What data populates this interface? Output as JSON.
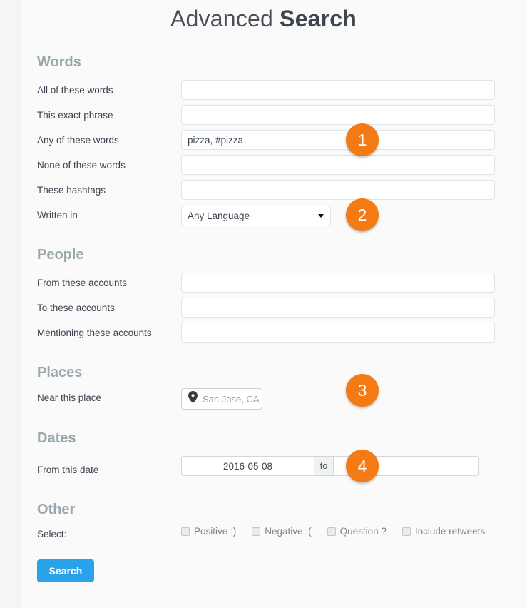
{
  "title": {
    "light": "Advanced ",
    "bold": "Search"
  },
  "sections": {
    "words": {
      "heading": "Words",
      "rows": [
        {
          "label": "All of these words",
          "value": "",
          "placeholder": ""
        },
        {
          "label": "This exact phrase",
          "value": "",
          "placeholder": ""
        },
        {
          "label": "Any of these words",
          "value": "pizza, #pizza",
          "placeholder": ""
        },
        {
          "label": "None of these words",
          "value": "",
          "placeholder": ""
        },
        {
          "label": "These hashtags",
          "value": "",
          "placeholder": ""
        }
      ],
      "language": {
        "label": "Written in",
        "selected": "Any Language",
        "caret_icon": "chevron-down-icon"
      }
    },
    "people": {
      "heading": "People",
      "rows": [
        {
          "label": "From these accounts",
          "value": "",
          "placeholder": ""
        },
        {
          "label": "To these accounts",
          "value": "",
          "placeholder": ""
        },
        {
          "label": "Mentioning these accounts",
          "value": "",
          "placeholder": ""
        }
      ]
    },
    "places": {
      "heading": "Places",
      "label": "Near this place",
      "icon": "map-pin-icon",
      "value": "San Jose, CA"
    },
    "dates": {
      "heading": "Dates",
      "label": "From this date",
      "from_value": "2016-05-08",
      "separator": "to",
      "to_value": ""
    },
    "other": {
      "heading": "Other",
      "label": "Select:",
      "checkboxes": [
        {
          "label": "Positive :)",
          "checked": false
        },
        {
          "label": "Negative :(",
          "checked": false
        },
        {
          "label": "Question ?",
          "checked": false
        },
        {
          "label": "Include retweets",
          "checked": false
        }
      ]
    }
  },
  "submit": {
    "label": "Search"
  },
  "badges": [
    {
      "number": "1"
    },
    {
      "number": "2"
    },
    {
      "number": "3"
    },
    {
      "number": "4"
    }
  ],
  "colors": {
    "accent_badge": "#f47a13",
    "button_blue": "#28a2e8",
    "heading_grey": "#9aa8ad",
    "page_background": "#fafafa"
  }
}
